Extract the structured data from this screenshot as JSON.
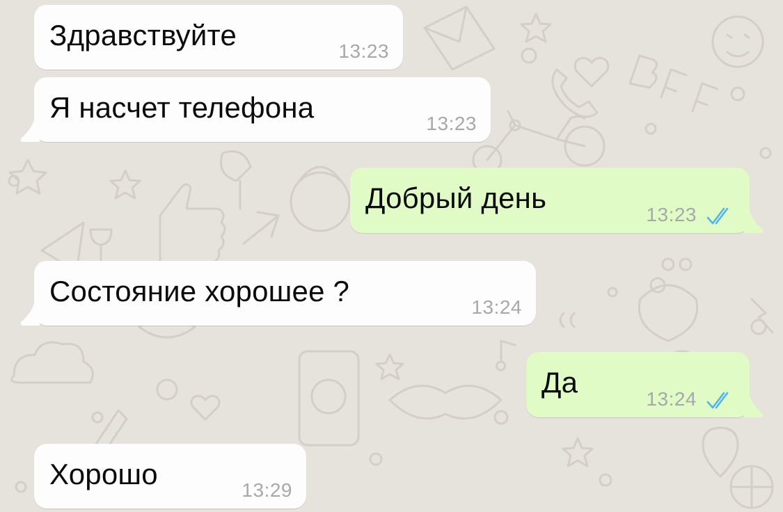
{
  "theme": {
    "background": "#e6e2dc",
    "incoming_bubble": "#fdfdfd",
    "outgoing_bubble": "#e1fbc7",
    "time_color": "#a6a8aa",
    "read_check_color": "#4fb5ec",
    "doodle_color": "#d3cfc8"
  },
  "messages": [
    {
      "direction": "incoming",
      "text": "Здравствуйте",
      "time": "13:23"
    },
    {
      "direction": "incoming",
      "text": "Я насчет телефона",
      "time": "13:23"
    },
    {
      "direction": "outgoing",
      "text": "Добрый день",
      "time": "13:23",
      "status_icon": "double-check-read-icon"
    },
    {
      "direction": "incoming",
      "text": "Состояние хорошее ?",
      "time": "13:24"
    },
    {
      "direction": "outgoing",
      "text": "Да",
      "time": "13:24",
      "status_icon": "double-check-read-icon"
    },
    {
      "direction": "incoming",
      "text": "Хорошо",
      "time": "13:29"
    }
  ]
}
